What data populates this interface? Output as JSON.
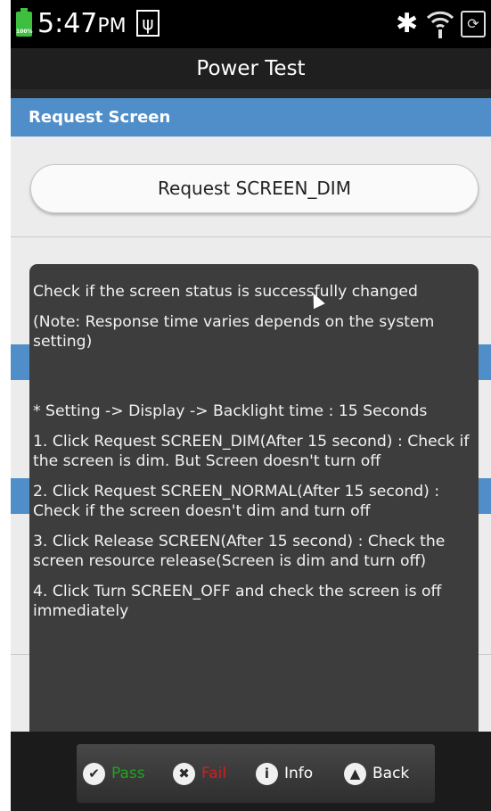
{
  "status_bar": {
    "battery_pct": "100%",
    "time": "5:47",
    "ampm": "PM",
    "usb_glyph": "ψ",
    "bluetooth_glyph": "✱",
    "sync_glyph": "⟳"
  },
  "title_bar": {
    "title": "Power Test"
  },
  "section": {
    "header": "Request Screen"
  },
  "request_button": {
    "label": "Request SCREEN_DIM"
  },
  "info": {
    "line1": "Check if the screen status is successfully changed",
    "line2": "(Note: Response time varies depends on the system setting)",
    "line3": "* Setting -> Display -> Backlight time : 15 Seconds",
    "line4": "1. Click Request SCREEN_DIM(After 15 second) : Check if the screen is dim. But Screen doesn't turn off",
    "line5": "2. Click Request SCREEN_NORMAL(After 15 second) : Check if the screen doesn't dim and turn off",
    "line6": "3. Click Release SCREEN(After 15 second) : Check the screen resource release(Screen is dim and turn off)",
    "line7": "4. Click Turn SCREEN_OFF and check the screen is off immediately"
  },
  "bottom_bar": {
    "pass": {
      "label": "Pass",
      "glyph": "✔",
      "color": "#22a322"
    },
    "fail": {
      "label": "Fail",
      "glyph": "✖",
      "color": "#d21e1e"
    },
    "info": {
      "label": "Info",
      "glyph": "i"
    },
    "back": {
      "label": "Back",
      "glyph": "▲"
    }
  },
  "colors": {
    "accent": "#4f8ec8",
    "overlay": "#3d3d3d"
  }
}
